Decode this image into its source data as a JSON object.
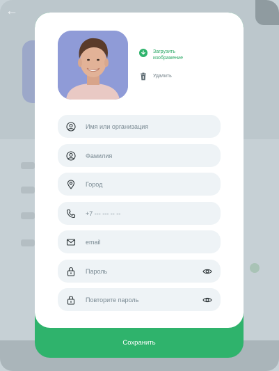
{
  "background": {
    "accent_color": "#2fb36c"
  },
  "profile": {
    "upload_label": "Загрузить изображение",
    "delete_label": "Удалить"
  },
  "fields": [
    {
      "name": "organization",
      "placeholder": "Имя или организация",
      "icon": "user-circle-icon"
    },
    {
      "name": "surname",
      "placeholder": "Фамилия",
      "icon": "user-circle-icon"
    },
    {
      "name": "city",
      "placeholder": "Город",
      "icon": "location-pin-icon"
    },
    {
      "name": "phone",
      "placeholder": "+7 --- --- -- --",
      "icon": "phone-icon"
    },
    {
      "name": "email",
      "placeholder": "email",
      "icon": "mail-icon"
    },
    {
      "name": "password",
      "placeholder": "Пароль",
      "icon": "lock-icon"
    },
    {
      "name": "password_repeat",
      "placeholder": "Повторите пароль",
      "icon": "lock-icon"
    }
  ],
  "actions": {
    "save_label": "Сохранить"
  }
}
